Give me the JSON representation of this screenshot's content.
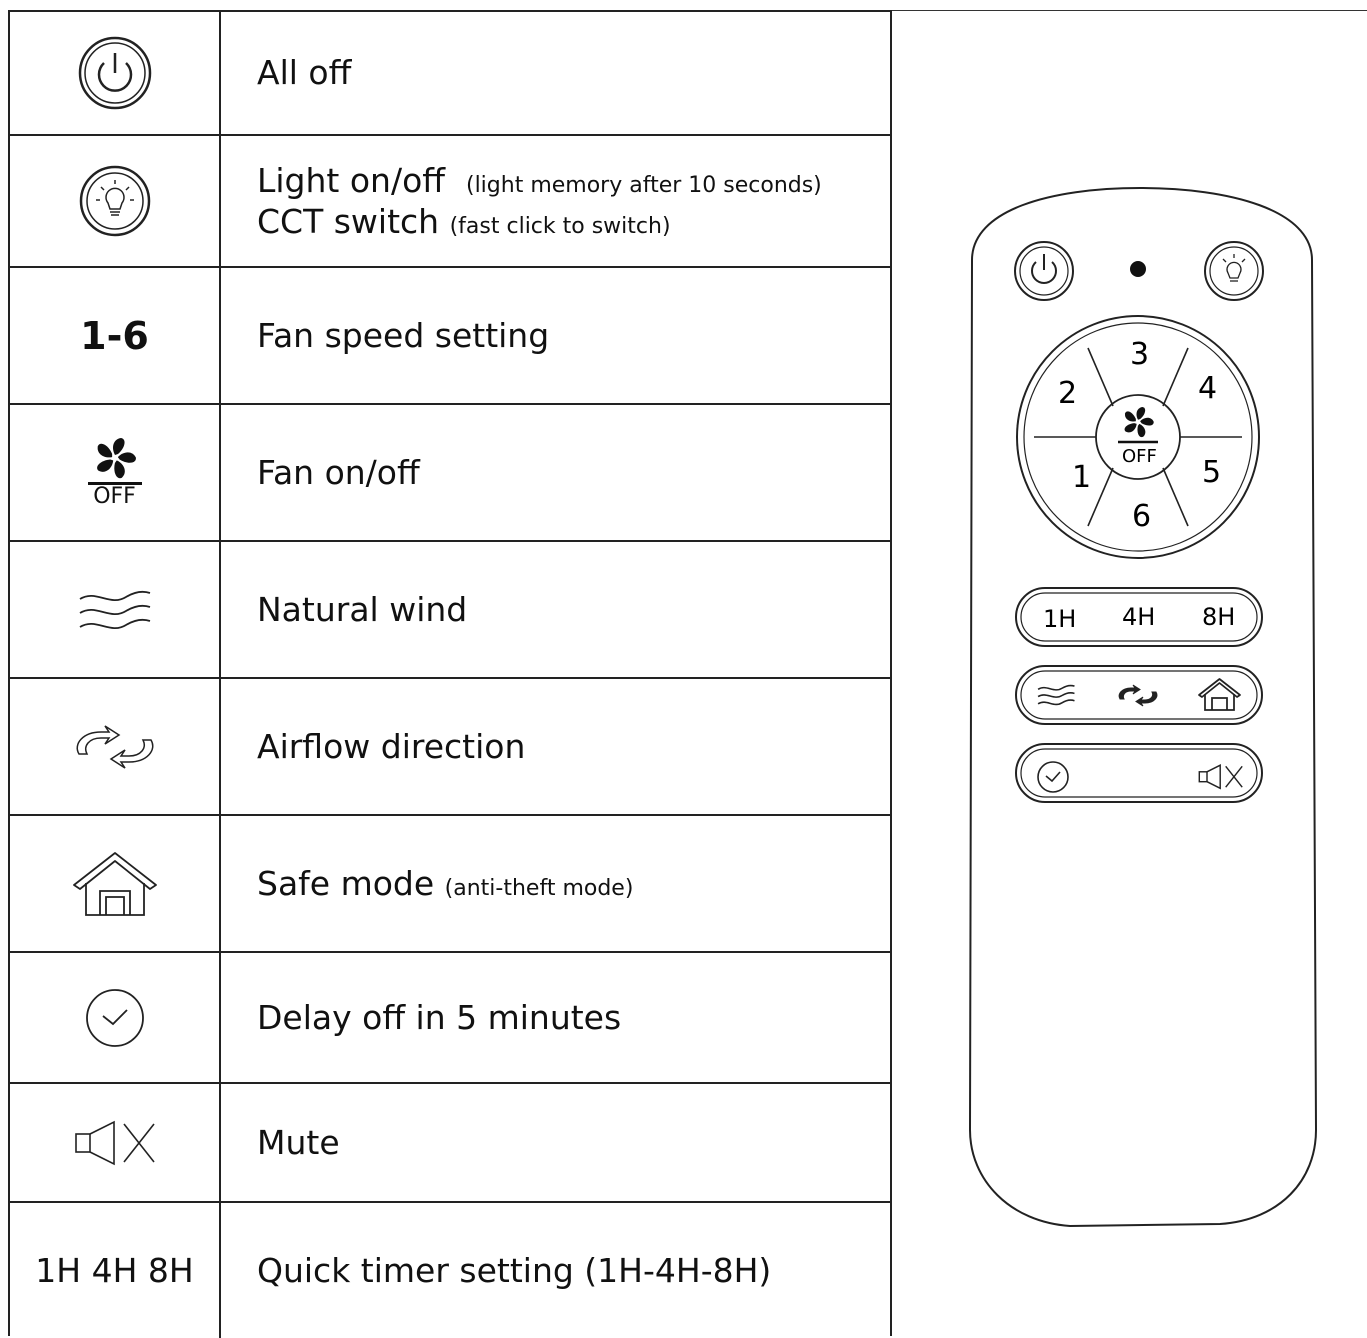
{
  "legend": {
    "rows": [
      {
        "icon": "power-icon",
        "label": "All off",
        "note": ""
      },
      {
        "icon": "bulb-icon",
        "label": "Light on/off",
        "note": "(light memory after 10 seconds)",
        "label2": "CCT switch",
        "note2": "(fast click to switch)"
      },
      {
        "icon_text": "1-6",
        "label": "Fan speed setting",
        "note": ""
      },
      {
        "icon": "fan-off-icon",
        "icon_sub": "OFF",
        "label": "Fan on/off",
        "note": ""
      },
      {
        "icon": "wind-icon",
        "label": "Natural wind",
        "note": ""
      },
      {
        "icon": "airflow-icon",
        "label": "Airflow direction",
        "note": ""
      },
      {
        "icon": "house-icon",
        "label": "Safe mode",
        "note": "(anti-theft mode)"
      },
      {
        "icon": "clock-icon",
        "label": "Delay off in 5 minutes",
        "note": ""
      },
      {
        "icon": "mute-icon",
        "label": "Mute",
        "note": ""
      },
      {
        "icon_text": "1H 4H 8H",
        "label": "Quick timer setting (1H-4H-8H)",
        "note": ""
      }
    ]
  },
  "remote": {
    "speeds": [
      "1",
      "2",
      "3",
      "4",
      "5",
      "6"
    ],
    "center_label": "OFF",
    "timers": [
      "1H",
      "4H",
      "8H"
    ],
    "function_icons": [
      "wind-icon",
      "airflow-icon",
      "house-icon"
    ],
    "bottom_icons": [
      "clock-icon",
      "mute-icon"
    ],
    "top_icons": [
      "power-icon",
      "indicator-led",
      "bulb-icon"
    ]
  },
  "colors": {
    "line": "#222222",
    "background": "#ffffff"
  }
}
